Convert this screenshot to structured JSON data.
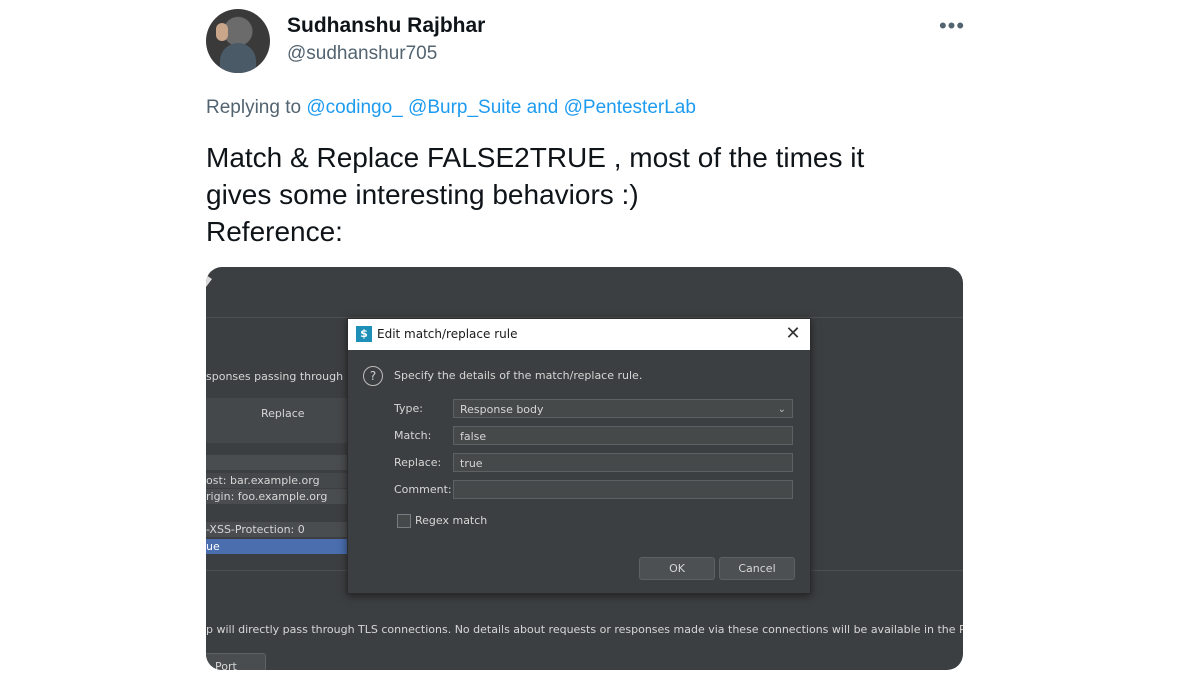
{
  "author": {
    "name": "Sudhanshu Rajbhar",
    "handle": "@sudhanshur705",
    "more_label": "•••"
  },
  "reply": {
    "prefix": "Replying to",
    "mentions": [
      "@codingo_",
      "@Burp_Suite"
    ],
    "joiner": "and",
    "last_mention": "@PentesterLab"
  },
  "tweet": {
    "lines": [
      "Match & Replace FALSE2TRUE , most of the times it",
      "gives some interesting behaviors :)",
      "Reference:"
    ]
  },
  "screenshot": {
    "left_fragment": "sponses passing through",
    "column_header": "Replace",
    "rows": [
      "ost: bar.example.org",
      "rigin: foo.example.org",
      "-XSS-Protection: 0",
      "ue"
    ],
    "bottom_text": "p will directly pass through TLS connections. No details about requests or responses made via these connections will be available in the Proxy",
    "port_button": "Port",
    "dialog": {
      "app_icon": "$",
      "title": "Edit match/replace rule",
      "close": "✕",
      "help_icon": "?",
      "description": "Specify the details of the match/replace rule.",
      "type_label": "Type:",
      "type_value": "Response body",
      "match_label": "Match:",
      "match_value": "false",
      "replace_label": "Replace:",
      "replace_value": "true",
      "comment_label": "Comment:",
      "comment_value": "",
      "regex_label": "Regex match",
      "ok_label": "OK",
      "cancel_label": "Cancel"
    }
  }
}
